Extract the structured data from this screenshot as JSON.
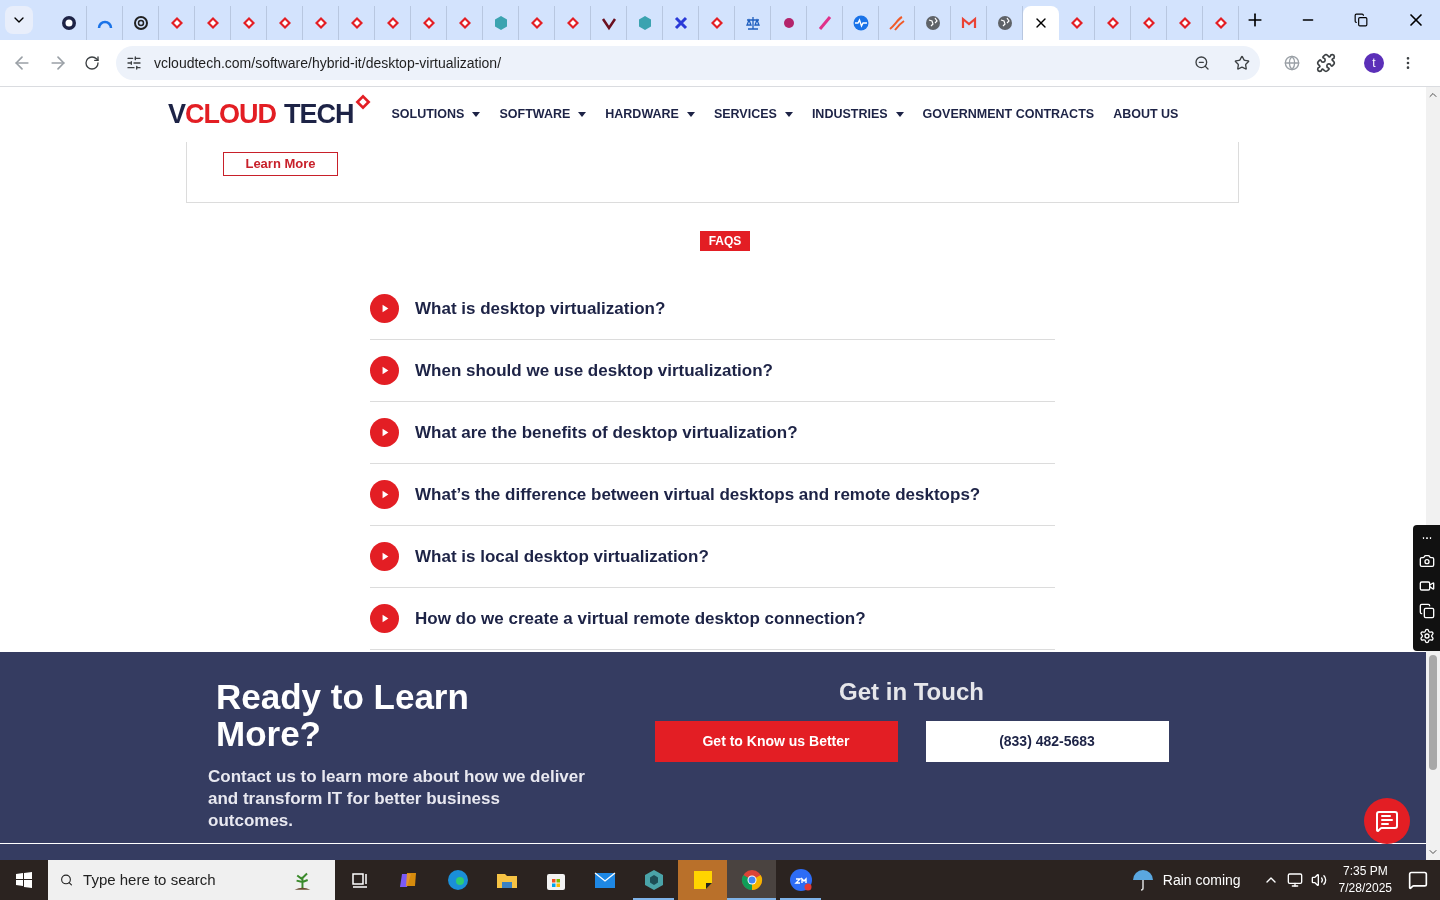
{
  "browser": {
    "tabs": [
      {
        "kind": "dark-circle",
        "selected": false
      },
      {
        "kind": "arc",
        "selected": false
      },
      {
        "kind": "knot",
        "selected": false
      },
      {
        "kind": "logo",
        "selected": false
      },
      {
        "kind": "logo",
        "selected": false
      },
      {
        "kind": "logo",
        "selected": false
      },
      {
        "kind": "logo",
        "selected": false
      },
      {
        "kind": "logo",
        "selected": false
      },
      {
        "kind": "logo",
        "selected": false
      },
      {
        "kind": "logo",
        "selected": false
      },
      {
        "kind": "logo",
        "selected": false
      },
      {
        "kind": "logo",
        "selected": false
      },
      {
        "kind": "hex",
        "selected": false
      },
      {
        "kind": "logo",
        "selected": false
      },
      {
        "kind": "logo",
        "selected": false
      },
      {
        "kind": "check",
        "selected": false
      },
      {
        "kind": "hex",
        "selected": false
      },
      {
        "kind": "cross",
        "selected": false
      },
      {
        "kind": "logo",
        "selected": false
      },
      {
        "kind": "scale",
        "selected": false
      },
      {
        "kind": "ball",
        "selected": false
      },
      {
        "kind": "feather",
        "selected": false
      },
      {
        "kind": "pulse",
        "selected": false
      },
      {
        "kind": "swirl",
        "selected": false
      },
      {
        "kind": "globe",
        "selected": false
      },
      {
        "kind": "mail",
        "selected": false
      },
      {
        "kind": "globe",
        "selected": false
      },
      {
        "kind": "blank",
        "selected": true
      },
      {
        "kind": "logo",
        "selected": false
      },
      {
        "kind": "logo",
        "selected": false
      },
      {
        "kind": "logo",
        "selected": false
      },
      {
        "kind": "logo",
        "selected": false
      },
      {
        "kind": "logo",
        "selected": false
      }
    ],
    "address": "vcloudtech.com/software/hybrid-it/desktop-virtualization/",
    "profile_initial": "t"
  },
  "site": {
    "logo": {
      "words": [
        [
          {
            "text": "V",
            "accent": false
          },
          {
            "text": "CLOUD",
            "accent": true
          }
        ],
        [
          {
            "text": "TECH",
            "accent": false
          }
        ]
      ]
    },
    "nav": [
      {
        "label": "SOLUTIONS",
        "has_menu": true
      },
      {
        "label": "SOFTWARE",
        "has_menu": true
      },
      {
        "label": "HARDWARE",
        "has_menu": true
      },
      {
        "label": "SERVICES",
        "has_menu": true
      },
      {
        "label": "INDUSTRIES",
        "has_menu": true
      },
      {
        "label": "GOVERNMENT CONTRACTS",
        "has_menu": false
      },
      {
        "label": "ABOUT US",
        "has_menu": false
      }
    ],
    "card": {
      "button": "Learn More"
    },
    "faq": {
      "badge": "FAQS",
      "items": [
        {
          "question": "What is desktop virtualization?",
          "expanded": false
        },
        {
          "question": "When should we use desktop virtualization?",
          "expanded": false
        },
        {
          "question": "What are the benefits of desktop virtualization?",
          "expanded": false
        },
        {
          "question": "What’s the difference between virtual desktops and remote desktops?",
          "expanded": false
        },
        {
          "question": "What is local desktop virtualization?",
          "expanded": false
        },
        {
          "question": "How do we create a virtual remote desktop connection?",
          "expanded": false
        }
      ]
    },
    "footer": {
      "heading": "Ready to Learn More?",
      "text": "Contact us to learn more about how we deliver and transform IT for better business outcomes.",
      "contact_title": "Get in Touch",
      "buttons": [
        {
          "label": "Get to Know us Better",
          "kind": "primary"
        },
        {
          "label": "(833) 482-5683",
          "kind": "outline"
        }
      ]
    }
  },
  "taskbar": {
    "search_placeholder": "Type here to search",
    "apps": [
      {
        "kind": "taskview",
        "running": false,
        "focused": false,
        "flashing": false
      },
      {
        "kind": "copilot",
        "running": false,
        "focused": false,
        "flashing": false
      },
      {
        "kind": "edge",
        "running": false,
        "focused": false,
        "flashing": false
      },
      {
        "kind": "folder",
        "running": false,
        "focused": false,
        "flashing": false
      },
      {
        "kind": "store",
        "running": false,
        "focused": false,
        "flashing": false
      },
      {
        "kind": "mail",
        "running": false,
        "focused": false,
        "flashing": false
      },
      {
        "kind": "hex",
        "running": true,
        "focused": false,
        "flashing": false
      },
      {
        "kind": "sticky",
        "running": false,
        "focused": false,
        "flashing": true
      },
      {
        "kind": "chrome",
        "running": true,
        "focused": true,
        "flashing": false
      },
      {
        "kind": "zoom",
        "running": true,
        "focused": false,
        "flashing": false
      }
    ],
    "weather": "Rain coming",
    "time": "7:35 PM",
    "date": "7/28/2025"
  }
}
